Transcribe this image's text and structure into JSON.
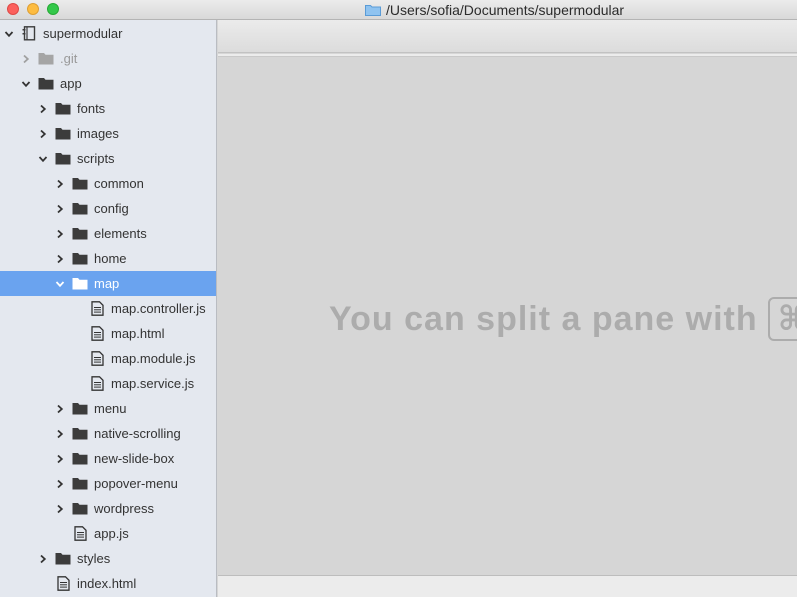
{
  "window": {
    "title": "/Users/sofia/Documents/supermodular",
    "title_icon": "folder-icon",
    "accent_color": "#6aa3ef"
  },
  "tree": [
    {
      "label": "supermodular",
      "level": 0,
      "type": "repo",
      "expanded": true,
      "name": "tree-item-supermodular"
    },
    {
      "label": ".git",
      "level": 1,
      "type": "folder",
      "expanded": false,
      "muted": true,
      "name": "tree-item-git"
    },
    {
      "label": "app",
      "level": 1,
      "type": "folder",
      "expanded": true,
      "name": "tree-item-app"
    },
    {
      "label": "fonts",
      "level": 2,
      "type": "folder",
      "expanded": false,
      "name": "tree-item-fonts"
    },
    {
      "label": "images",
      "level": 2,
      "type": "folder",
      "expanded": false,
      "name": "tree-item-images"
    },
    {
      "label": "scripts",
      "level": 2,
      "type": "folder",
      "expanded": true,
      "name": "tree-item-scripts"
    },
    {
      "label": "common",
      "level": 3,
      "type": "folder",
      "expanded": false,
      "name": "tree-item-common"
    },
    {
      "label": "config",
      "level": 3,
      "type": "folder",
      "expanded": false,
      "name": "tree-item-config"
    },
    {
      "label": "elements",
      "level": 3,
      "type": "folder",
      "expanded": false,
      "name": "tree-item-elements"
    },
    {
      "label": "home",
      "level": 3,
      "type": "folder",
      "expanded": false,
      "name": "tree-item-home"
    },
    {
      "label": "map",
      "level": 3,
      "type": "folder",
      "expanded": true,
      "selected": true,
      "name": "tree-item-map"
    },
    {
      "label": "map.controller.js",
      "level": 4,
      "type": "file",
      "name": "tree-item-map-controller-js"
    },
    {
      "label": "map.html",
      "level": 4,
      "type": "file",
      "name": "tree-item-map-html"
    },
    {
      "label": "map.module.js",
      "level": 4,
      "type": "file",
      "name": "tree-item-map-module-js"
    },
    {
      "label": "map.service.js",
      "level": 4,
      "type": "file",
      "name": "tree-item-map-service-js"
    },
    {
      "label": "menu",
      "level": 3,
      "type": "folder",
      "expanded": false,
      "name": "tree-item-menu"
    },
    {
      "label": "native-scrolling",
      "level": 3,
      "type": "folder",
      "expanded": false,
      "name": "tree-item-native-scrolling"
    },
    {
      "label": "new-slide-box",
      "level": 3,
      "type": "folder",
      "expanded": false,
      "name": "tree-item-new-slide-box"
    },
    {
      "label": "popover-menu",
      "level": 3,
      "type": "folder",
      "expanded": false,
      "name": "tree-item-popover-menu"
    },
    {
      "label": "wordpress",
      "level": 3,
      "type": "folder",
      "expanded": false,
      "name": "tree-item-wordpress"
    },
    {
      "label": "app.js",
      "level": 3,
      "type": "file",
      "name": "tree-item-app-js"
    },
    {
      "label": "styles",
      "level": 2,
      "type": "folder",
      "expanded": false,
      "name": "tree-item-styles"
    },
    {
      "label": "index.html",
      "level": 2,
      "type": "file",
      "name": "tree-item-index-html"
    }
  ],
  "main": {
    "hint_text": "You can split a pane with",
    "hint_key": "⌘"
  }
}
